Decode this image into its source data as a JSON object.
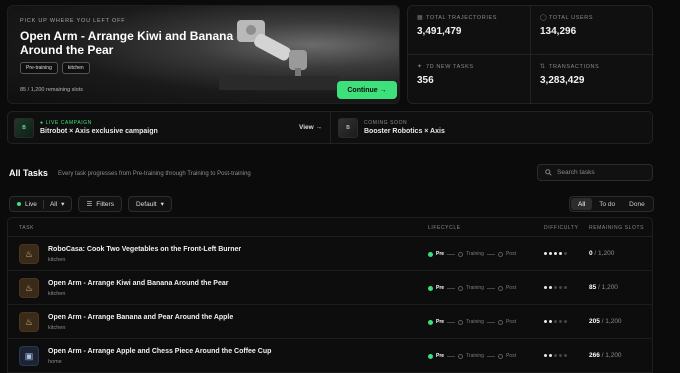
{
  "hero": {
    "kicker": "PICK UP WHERE YOU LEFT OFF",
    "title": "Open Arm - Arrange Kiwi and Banana Around the Pear",
    "tags": [
      "Pre-training",
      "kitchen"
    ],
    "slots": "85 / 1,200 remaining slots",
    "cta": "Continue →"
  },
  "stats": [
    {
      "label": "TOTAL TRAJECTORIES",
      "value": "3,491,479",
      "icon": "grid-icon"
    },
    {
      "label": "TOTAL USERS",
      "value": "134,296",
      "icon": "user-icon"
    },
    {
      "label": "7D NEW TASKS",
      "value": "356",
      "icon": "sparkle-icon"
    },
    {
      "label": "TRANSACTIONS",
      "value": "3,283,429",
      "icon": "transfer-icon"
    }
  ],
  "campaigns": [
    {
      "kicker": "● LIVE CAMPAIGN",
      "name": "Bitrobot × Axis exclusive campaign",
      "action": "View →"
    },
    {
      "kicker": "COMING SOON",
      "name": "Booster Robotics × Axis"
    }
  ],
  "tasks": {
    "title": "All Tasks",
    "subtitle": "Every task progresses from Pre-training through Training to Post-training",
    "search_placeholder": "Search tasks"
  },
  "filters": {
    "live": "Live",
    "all": "All",
    "filters": "Filters",
    "sort": "Default",
    "segments": [
      "All",
      "To do",
      "Done"
    ]
  },
  "table": {
    "headers": {
      "task": "TASK",
      "lifecycle": "LIFECYCLE",
      "difficulty": "DIFFICULTY",
      "slots": "REMAINING SLOTS"
    },
    "stages": [
      "Pre",
      "Training",
      "Post"
    ],
    "rows": [
      {
        "name": "RoboCasa: Cook Two Vegetables on the Front-Left Burner",
        "category": "kitchen",
        "difficulty": 4,
        "remaining": "0",
        "total": " / 1,200"
      },
      {
        "name": "Open Arm - Arrange Kiwi and Banana Around the Pear",
        "category": "kitchen",
        "difficulty": 2,
        "remaining": "85",
        "total": " / 1,200"
      },
      {
        "name": "Open Arm - Arrange Banana and Pear Around the Apple",
        "category": "kitchen",
        "difficulty": 2,
        "remaining": "205",
        "total": " / 1,200"
      },
      {
        "name": "Open Arm - Arrange Apple and Chess Piece Around the Coffee Cup",
        "category": "home",
        "difficulty": 2,
        "remaining": "266",
        "total": " / 1,200"
      }
    ]
  }
}
